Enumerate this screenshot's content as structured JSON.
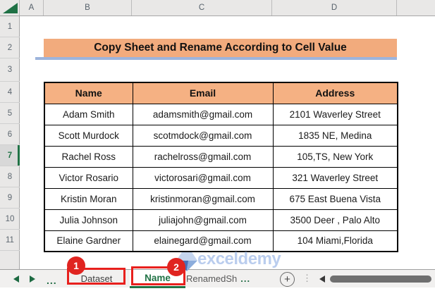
{
  "spreadsheet": {
    "column_headers": [
      "A",
      "B",
      "C",
      "D"
    ],
    "row_headers": [
      "1",
      "2",
      "3",
      "4",
      "5",
      "6",
      "7",
      "8",
      "9",
      "10",
      "11"
    ],
    "active_row": "7",
    "title_banner": "Copy Sheet and Rename According to Cell Value",
    "table": {
      "headers": [
        "Name",
        "Email",
        "Address"
      ],
      "rows": [
        [
          "Adam Smith",
          "adamsmith@gmail.com",
          "2101 Waverley Street"
        ],
        [
          "Scott Murdock",
          "scotmdock@gmail.com",
          "1835  NE, Medina"
        ],
        [
          "Rachel Ross",
          "rachelross@gmail.com",
          "105,TS, New York"
        ],
        [
          "Victor Rosario",
          "victorosari@gmail.com",
          "321 Waverley Street"
        ],
        [
          "Kristin Moran",
          "kristinmoran@gmail.com",
          "675 East Buena Vista"
        ],
        [
          "Julia Johnson",
          "juliajohn@gmail.com",
          "3500 Deer , Palo Alto"
        ],
        [
          "Elaine Gardner",
          "elainegard@gmail.com",
          "104 Miami,Florida"
        ]
      ]
    }
  },
  "watermark": {
    "text": "exceldemy"
  },
  "tabbar": {
    "overflow_left": "...",
    "tabs": [
      {
        "label": "Dataset",
        "active": false
      },
      {
        "label": "Name",
        "active": true
      },
      {
        "label": "RenamedSh",
        "suffix": "...",
        "active": false
      }
    ],
    "new_sheet_label": "+",
    "divider_dots": "⋮",
    "annotations": {
      "step1": "1",
      "step2": "2"
    }
  },
  "colors": {
    "banner_fill": "#f2ab7d",
    "table_header_fill": "#f5b183",
    "banner_underline_blue": "#9db4dc",
    "excel_green": "#217346",
    "annotation_red": "#e8201d",
    "watermark_blue": "#b7cbee"
  }
}
